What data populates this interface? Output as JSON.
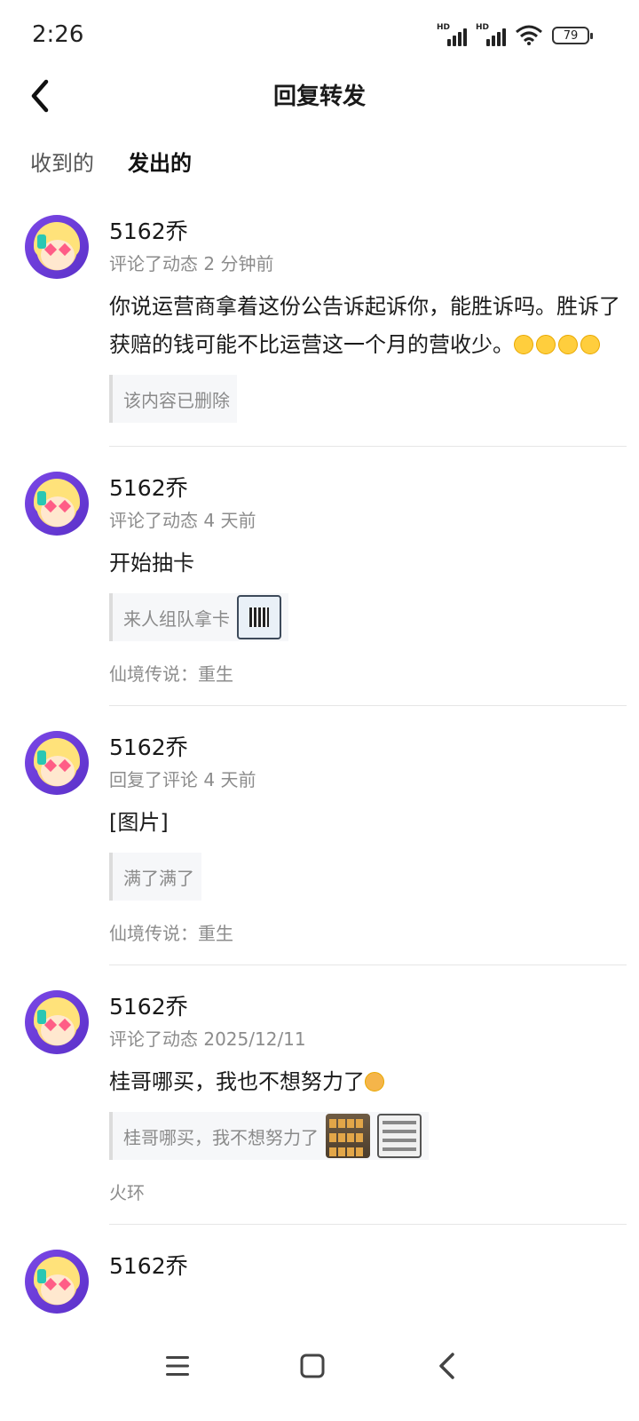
{
  "status_bar": {
    "time": "2:26",
    "battery": "79"
  },
  "header": {
    "title": "回复转发"
  },
  "tabs": [
    {
      "label": "收到的",
      "active": false
    },
    {
      "label": "发出的",
      "active": true
    }
  ],
  "items": [
    {
      "username": "5162乔",
      "meta": "评论了动态 2 分钟前",
      "text": "你说运营商拿着这份公告诉起诉你，能胜诉吗。胜诉了获赔的钱可能不比运营这一个月的营收少。",
      "emoji_count": 4,
      "quote": "该内容已删除"
    },
    {
      "username": "5162乔",
      "meta": "评论了动态 4 天前",
      "text": "开始抽卡",
      "quote": "来人组队拿卡",
      "game": "仙境传说：重生"
    },
    {
      "username": "5162乔",
      "meta": "回复了评论 4 天前",
      "text": "[图片]",
      "quote": "满了满了",
      "game": "仙境传说：重生"
    },
    {
      "username": "5162乔",
      "meta": "评论了动态 2025/12/11",
      "text": "桂哥哪买，我也不想努力了",
      "quote": "桂哥哪买，我不想努力了",
      "game": "火环"
    },
    {
      "username": "5162乔"
    }
  ],
  "colors": {
    "accent": "#2ed3b6",
    "avatar_bg": "#6b3fdc"
  },
  "icons": {
    "back": "chevron-left-icon",
    "menu": "menu-icon",
    "home": "home-square-icon",
    "nav_back": "nav-back-icon"
  }
}
